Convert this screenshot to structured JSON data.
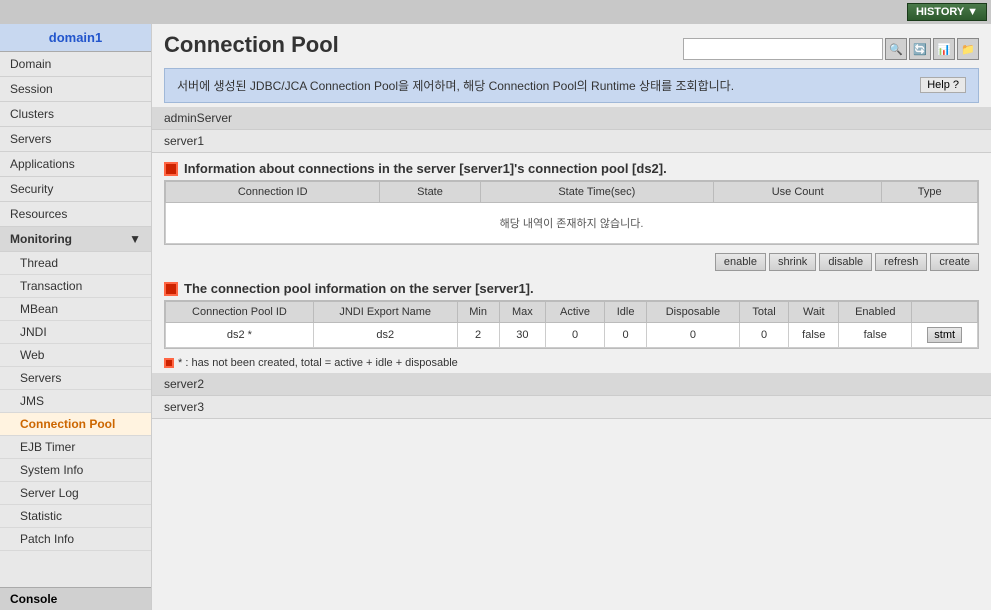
{
  "topBar": {
    "historyBtn": "HISTORY ▼"
  },
  "sidebar": {
    "domain": "domain1",
    "items": [
      {
        "label": "Domain",
        "type": "item"
      },
      {
        "label": "Session",
        "type": "item"
      },
      {
        "label": "Clusters",
        "type": "item"
      },
      {
        "label": "Servers",
        "type": "item"
      },
      {
        "label": "Applications",
        "type": "item"
      },
      {
        "label": "Security",
        "type": "item"
      },
      {
        "label": "Resources",
        "type": "item"
      },
      {
        "label": "Monitoring",
        "type": "section"
      }
    ],
    "monitoringItems": [
      {
        "label": "Thread",
        "active": false
      },
      {
        "label": "Transaction",
        "active": false
      },
      {
        "label": "MBean",
        "active": false
      },
      {
        "label": "JNDI",
        "active": false
      },
      {
        "label": "Web",
        "active": false
      },
      {
        "label": "Servers",
        "active": false
      },
      {
        "label": "JMS",
        "active": false
      },
      {
        "label": "Connection Pool",
        "active": true
      },
      {
        "label": "EJB Timer",
        "active": false
      },
      {
        "label": "System Info",
        "active": false
      },
      {
        "label": "Server Log",
        "active": false
      },
      {
        "label": "Statistic",
        "active": false
      },
      {
        "label": "Patch Info",
        "active": false
      }
    ],
    "console": "Console"
  },
  "pageTitle": "Connection Pool",
  "toolbar": {
    "searchPlaceholder": "",
    "icons": [
      "🔍",
      "📋",
      "📊",
      "📁"
    ]
  },
  "infoBanner": {
    "text": "서버에 생성된 JDBC/JCA Connection Pool을 제어하며, 해당 Connection Pool의 Runtime 상태를 조회합니다.",
    "helpBtn": "Help ?"
  },
  "servers": [
    {
      "name": "adminServer"
    },
    {
      "name": "server1"
    }
  ],
  "section1": {
    "title": "Information about connections in the server [server1]'s connection pool [ds2].",
    "columns": [
      "Connection ID",
      "State",
      "State Time(sec)",
      "Use Count",
      "Type"
    ],
    "emptyMsg": "해당 내역이 존재하지 않습니다."
  },
  "actionButtons": [
    "enable",
    "shrink",
    "disable",
    "refresh",
    "create"
  ],
  "section2": {
    "title": "The connection pool information on the server [server1].",
    "columns": [
      "Connection Pool ID",
      "JNDI Export Name",
      "Min",
      "Max",
      "Active",
      "Idle",
      "Disposable",
      "Total",
      "Wait",
      "Enabled"
    ],
    "rows": [
      {
        "poolId": "ds2 *",
        "jndi": "ds2",
        "min": "2",
        "max": "30",
        "active": "0",
        "idle": "0",
        "disposable": "0",
        "total": "0",
        "wait": "false",
        "enabled": "false",
        "stmtBtn": "stmt"
      }
    ]
  },
  "note": "* : has not been created, total = active + idle + disposable",
  "bottomServers": [
    {
      "name": "server2"
    },
    {
      "name": "server3"
    }
  ]
}
